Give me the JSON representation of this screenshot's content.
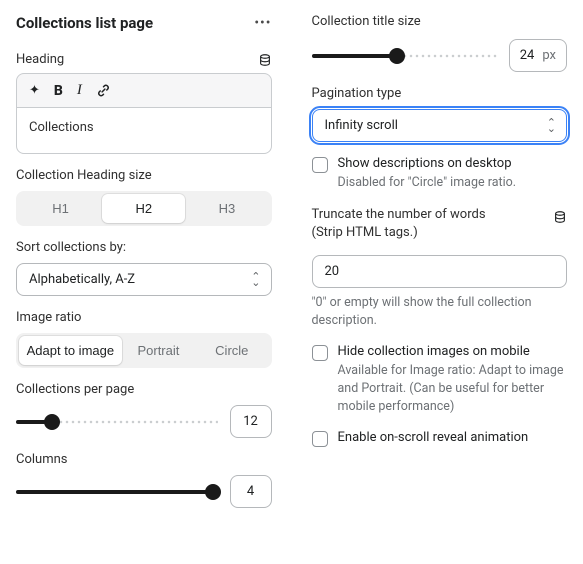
{
  "header": {
    "title": "Collections list page"
  },
  "left": {
    "heading_label": "Heading",
    "heading_value": "Collections",
    "collection_heading_size_label": "Collection Heading size",
    "heading_size_options": {
      "h1": "H1",
      "h2": "H2",
      "h3": "H3"
    },
    "heading_size_active": "h2",
    "sort_label": "Sort collections by:",
    "sort_value": "Alphabetically, A-Z",
    "image_ratio_label": "Image ratio",
    "image_ratio_options": {
      "adapt": "Adapt to image",
      "portrait": "Portrait",
      "circle": "Circle"
    },
    "image_ratio_active": "adapt",
    "collections_per_page_label": "Collections per page",
    "collections_per_page_value": "12",
    "columns_label": "Columns",
    "columns_value": "4"
  },
  "right": {
    "collection_title_size_label": "Collection title size",
    "collection_title_size_value": "24",
    "collection_title_size_unit": "px",
    "pagination_label": "Pagination type",
    "pagination_value": "Infinity scroll",
    "show_desc_label": "Show descriptions on desktop",
    "show_desc_help": "Disabled for \"Circle\" image ratio.",
    "truncate_label_line1": "Truncate the number of words",
    "truncate_label_line2": "(Strip HTML tags.)",
    "truncate_value": "20",
    "truncate_help": "\"0\" or empty will show the full collection description.",
    "hide_images_label": "Hide collection images on mobile",
    "hide_images_help": "Available for Image ratio: Adapt to image and Portrait. (Can be useful for better mobile performance)",
    "reveal_label": "Enable on-scroll reveal animation"
  }
}
